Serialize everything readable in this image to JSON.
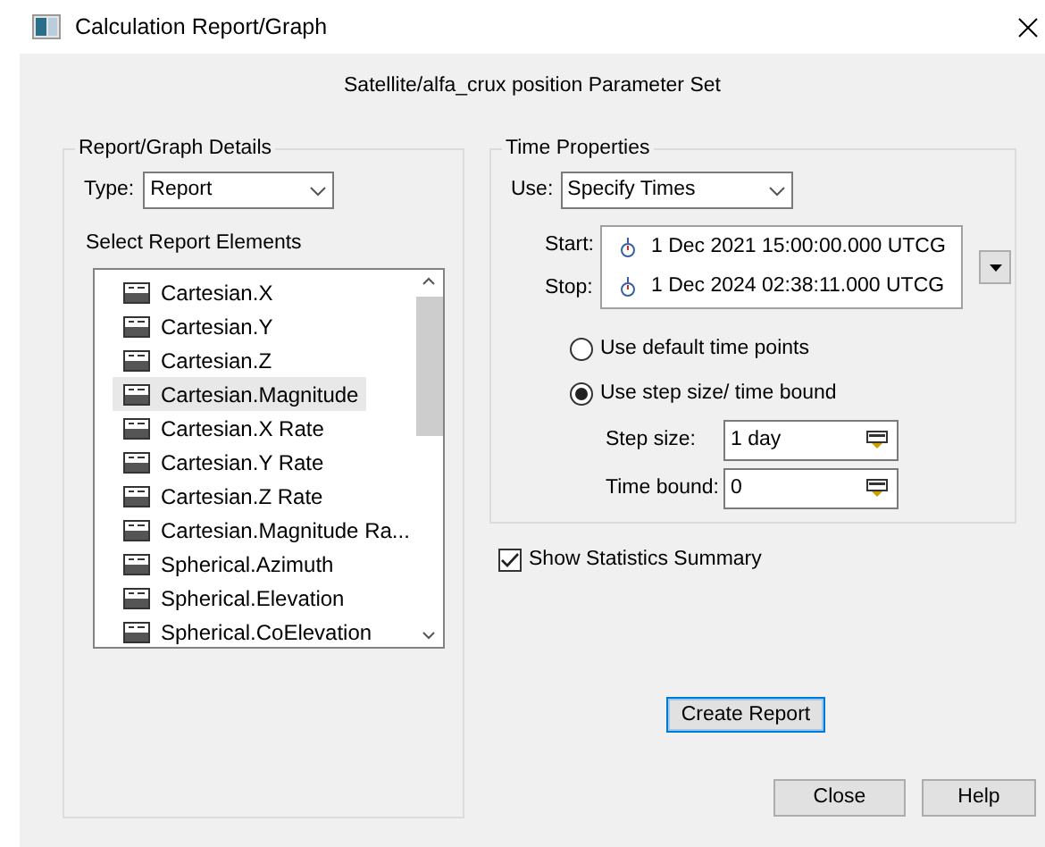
{
  "window": {
    "title": "Calculation Report/Graph"
  },
  "heading": "Satellite/alfa_crux position Parameter Set",
  "details": {
    "title": "Report/Graph Details",
    "type_label": "Type:",
    "type_value": "Report",
    "elements_label": "Select Report Elements",
    "elements": [
      {
        "label": "Cartesian.X",
        "selected": false
      },
      {
        "label": "Cartesian.Y",
        "selected": false
      },
      {
        "label": "Cartesian.Z",
        "selected": false
      },
      {
        "label": "Cartesian.Magnitude",
        "selected": true
      },
      {
        "label": "Cartesian.X Rate",
        "selected": false
      },
      {
        "label": "Cartesian.Y Rate",
        "selected": false
      },
      {
        "label": "Cartesian.Z Rate",
        "selected": false
      },
      {
        "label": "Cartesian.Magnitude Ra...",
        "selected": false
      },
      {
        "label": "Spherical.Azimuth",
        "selected": false
      },
      {
        "label": "Spherical.Elevation",
        "selected": false
      },
      {
        "label": "Spherical.CoElevation",
        "selected": false
      }
    ]
  },
  "time": {
    "title": "Time Properties",
    "use_label": "Use:",
    "use_value": "Specify Times",
    "start_label": "Start:",
    "start": "1 Dec 2021 15:00:00.000 UTCG",
    "stop_label": "Stop:",
    "stop": "1 Dec 2024 02:38:11.000 UTCG",
    "options": [
      {
        "label": "Use default time points",
        "selected": false
      },
      {
        "label": "Use step size/ time bound",
        "selected": true
      }
    ],
    "step_label": "Step size:",
    "step": "1 day",
    "bound_label": "Time bound:",
    "bound": "0"
  },
  "statistics": {
    "label": "Show Statistics Summary",
    "checked": true
  },
  "buttons": {
    "create": "Create Report",
    "close": "Close",
    "help": "Help"
  }
}
